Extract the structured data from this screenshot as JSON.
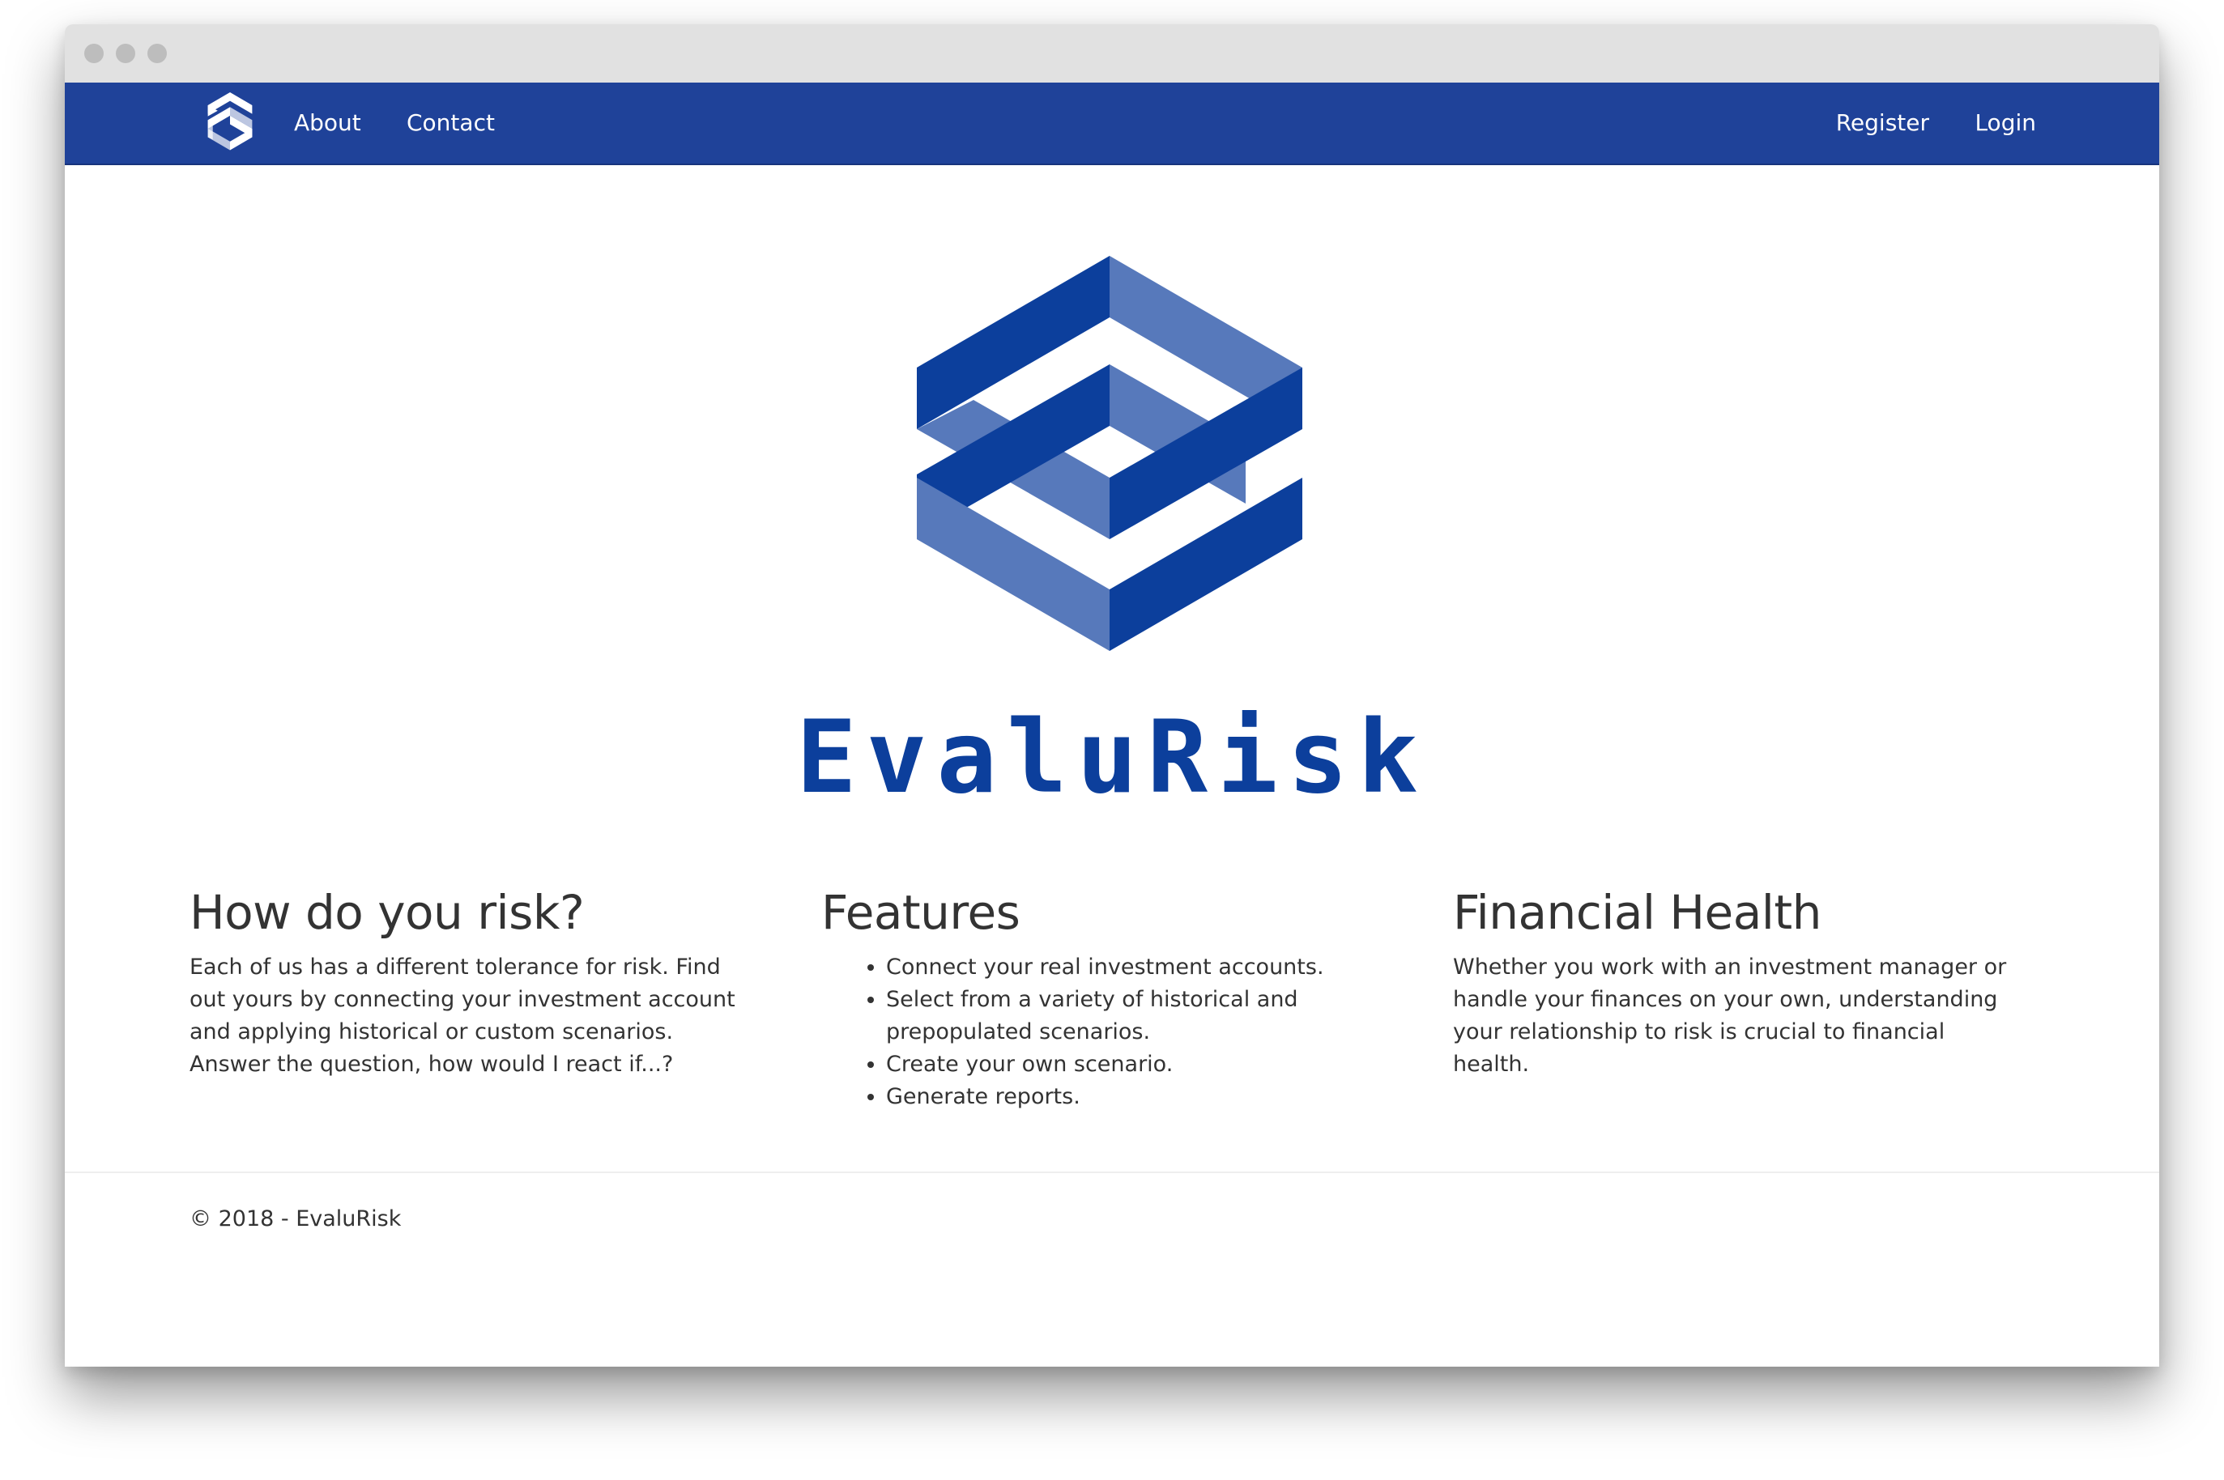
{
  "colors": {
    "navbar": "#1f4299",
    "brand": "#0c3f9c",
    "logo_dark": "#0c3f9c",
    "logo_light": "#5779bb",
    "text": "#333333"
  },
  "nav": {
    "logo_icon": "evalurisk-logo-icon",
    "left_links": [
      "About",
      "Contact"
    ],
    "right_links": [
      "Register",
      "Login"
    ]
  },
  "hero": {
    "logo_icon": "evalurisk-logo-icon",
    "brand_name": "EvaluRisk"
  },
  "columns": [
    {
      "heading": "How do you risk?",
      "body": "Each of us has a different tolerance for risk. Find out yours by connecting your investment account and applying historical or custom scenarios. Answer the question, how would I react if...?"
    },
    {
      "heading": "Features",
      "items": [
        "Connect your real investment accounts.",
        "Select from a variety of historical and prepopulated scenarios.",
        "Create your own scenario.",
        "Generate reports."
      ]
    },
    {
      "heading": "Financial Health",
      "body": "Whether you work with an investment manager or handle your finances on your own, understanding your relationship to risk is crucial to financial health."
    }
  ],
  "footer": {
    "text": "© 2018 - EvaluRisk"
  }
}
